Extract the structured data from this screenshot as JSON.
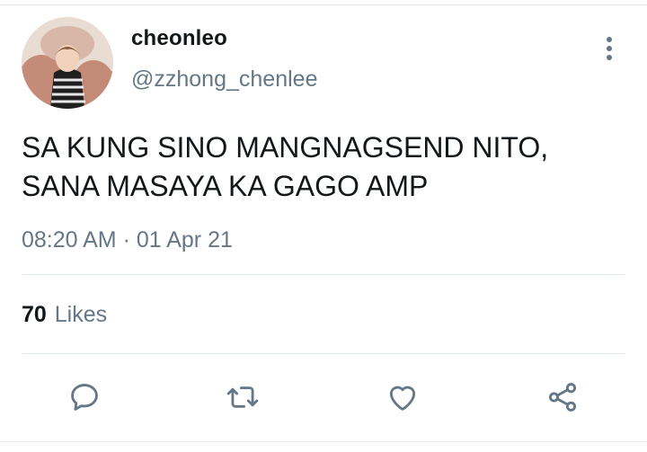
{
  "user": {
    "display_name": "cheonleo",
    "handle": "@zzhong_chenlee"
  },
  "tweet": {
    "text_line1": "SA KUNG SINO MANGNAGSEND NITO,",
    "text_line2": "SANA MASAYA KA GAGO AMP",
    "timestamp": "08:20 AM · 01 Apr 21"
  },
  "stats": {
    "likes_count": "70",
    "likes_label": "Likes"
  },
  "icons": {
    "more": "vertical-ellipsis-icon",
    "reply": "reply-icon",
    "retweet": "retweet-icon",
    "like": "heart-icon",
    "share": "share-icon"
  },
  "colors": {
    "text_primary": "#14171a",
    "text_secondary": "#657786",
    "icon": "#657786",
    "divider": "#e1e8ed"
  }
}
